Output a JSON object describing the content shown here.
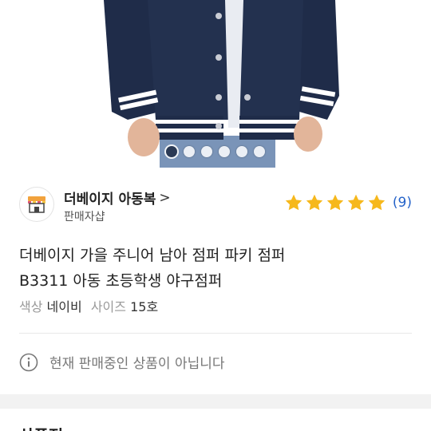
{
  "product_image": {
    "slides_total": 6,
    "active_slide": 1
  },
  "seller": {
    "name": "더베이지 아동복",
    "chevron": ">",
    "subtitle": "판매자샵",
    "rating_stars": 5,
    "review_count": "(9)"
  },
  "product": {
    "title_line1": "더베이지 가을 주니어 남아 점퍼 파키 점퍼",
    "title_line2": "B3311 아동 초등학생 야구점퍼",
    "options": [
      {
        "label": "색상",
        "value": "네이비"
      },
      {
        "label": "사이즈",
        "value": "15호"
      }
    ]
  },
  "notice": {
    "text": "현재 판매중인 상품이 아닙니다"
  },
  "next_section": {
    "title": "상품정"
  },
  "colors": {
    "jacket_navy": "#1f2c49",
    "star": "#f6b81c",
    "link_blue": "#2563c9"
  }
}
